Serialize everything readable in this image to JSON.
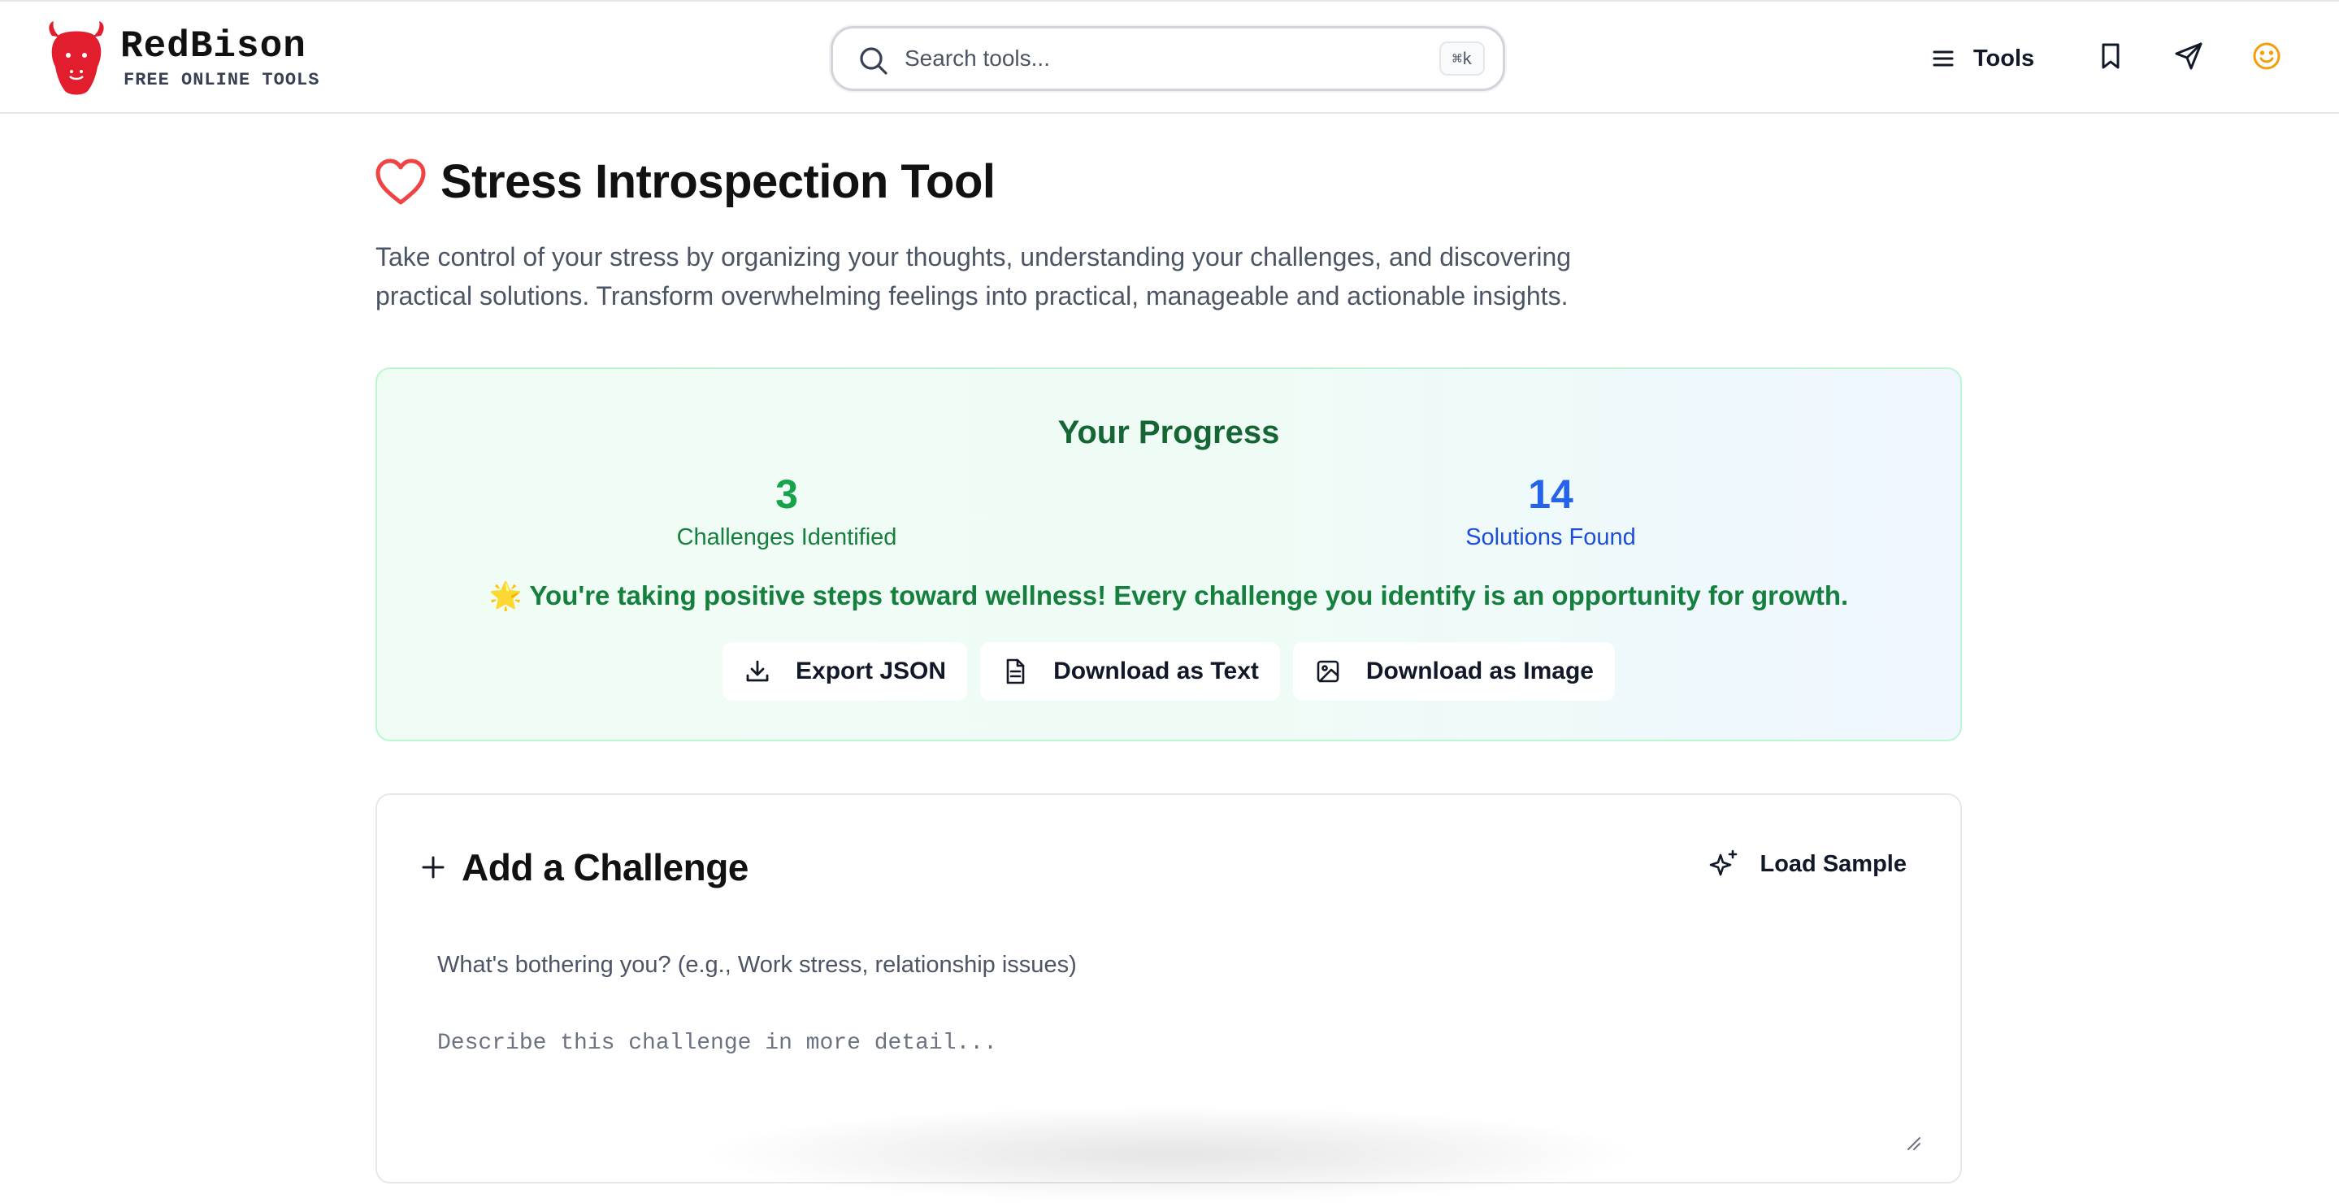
{
  "header": {
    "logo_title": "RedBison",
    "logo_subtitle": "FREE ONLINE TOOLS",
    "search_placeholder": "Search tools...",
    "search_shortcut": "⌘k",
    "nav_tools_label": "Tools"
  },
  "main": {
    "title": "Stress Introspection Tool",
    "intro": "Take control of your stress by organizing your thoughts, understanding your challenges, and discovering practical solutions. Transform overwhelming feelings into practical, manageable and actionable insights."
  },
  "progress": {
    "title": "Your Progress",
    "challenges_count": "3",
    "challenges_label": "Challenges Identified",
    "solutions_count": "14",
    "solutions_label": "Solutions Found",
    "motivation": "🌟 You're taking positive steps toward wellness! Every challenge you identify is an opportunity for growth.",
    "buttons": {
      "export_json": "Export JSON",
      "download_text": "Download as Text",
      "download_image": "Download as Image"
    }
  },
  "challenge_form": {
    "title": "Add a Challenge",
    "load_sample": "Load Sample",
    "title_placeholder": "What's bothering you? (e.g., Work stress, relationship issues)",
    "detail_placeholder": "Describe this challenge in more detail..."
  },
  "colors": {
    "brand_red": "#e11d2e",
    "progress_green": "#16a34a",
    "progress_blue": "#2563eb",
    "heart_red": "#ef4444",
    "avatar_orange": "#f59e0b"
  },
  "icons": {
    "logo": "bison-head-icon",
    "search": "search-icon",
    "menu": "menu-icon",
    "bookmark": "bookmark-icon",
    "send": "send-icon",
    "account": "smiley-icon",
    "title": "heart-icon",
    "export": "download-icon",
    "text": "file-text-icon",
    "image": "image-icon",
    "add": "plus-icon",
    "sample": "sparkles-icon"
  }
}
